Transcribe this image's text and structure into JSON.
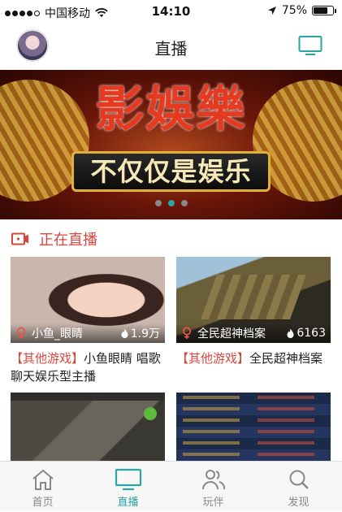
{
  "status_bar": {
    "carrier": "中国移动",
    "time": "14:10",
    "battery_percent": "75%",
    "battery_level": 0.75
  },
  "header": {
    "title": "直播",
    "tv_icon": "tv-icon",
    "avatar_icon": "avatar"
  },
  "banner": {
    "main_text": "影娛樂",
    "sub_text": "不仅仅是娱乐",
    "active_page": 2,
    "pages": 3
  },
  "live_section": {
    "title": "正在直播",
    "icon": "live-video-icon",
    "cards": [
      {
        "name": "小鱼_眼睛",
        "views": "1.9万",
        "tag": "【其他游戏】",
        "title": "小鱼眼睛 唱歌聊天娱乐型主播"
      },
      {
        "name": "全民超神档案",
        "views": "6163",
        "tag": "【其他游戏】",
        "title": "全民超神档案"
      }
    ]
  },
  "tabbar": {
    "items": [
      {
        "label": "首页",
        "icon": "home-icon"
      },
      {
        "label": "直播",
        "icon": "tv-icon"
      },
      {
        "label": "玩伴",
        "icon": "users-icon"
      },
      {
        "label": "发现",
        "icon": "search-icon"
      }
    ],
    "active_index": 1
  },
  "colors": {
    "accent": "#2aa6a5",
    "live_red": "#d9453b"
  }
}
